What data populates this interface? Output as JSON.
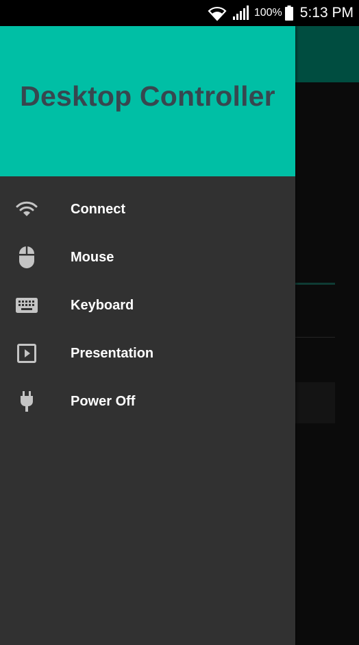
{
  "status_bar": {
    "battery_percent": "100%",
    "time": "5:13 PM",
    "icons": [
      "wifi-icon",
      "signal-icon",
      "battery-icon"
    ]
  },
  "drawer": {
    "title": "Desktop Controller",
    "header_color": "#00bfa5",
    "title_color": "#37474f",
    "background_color": "#313131",
    "items": [
      {
        "label": "Connect",
        "icon": "wifi-icon"
      },
      {
        "label": "Mouse",
        "icon": "mouse-icon"
      },
      {
        "label": "Keyboard",
        "icon": "keyboard-icon"
      },
      {
        "label": "Presentation",
        "icon": "play-icon"
      },
      {
        "label": "Power Off",
        "icon": "plug-icon"
      }
    ]
  }
}
